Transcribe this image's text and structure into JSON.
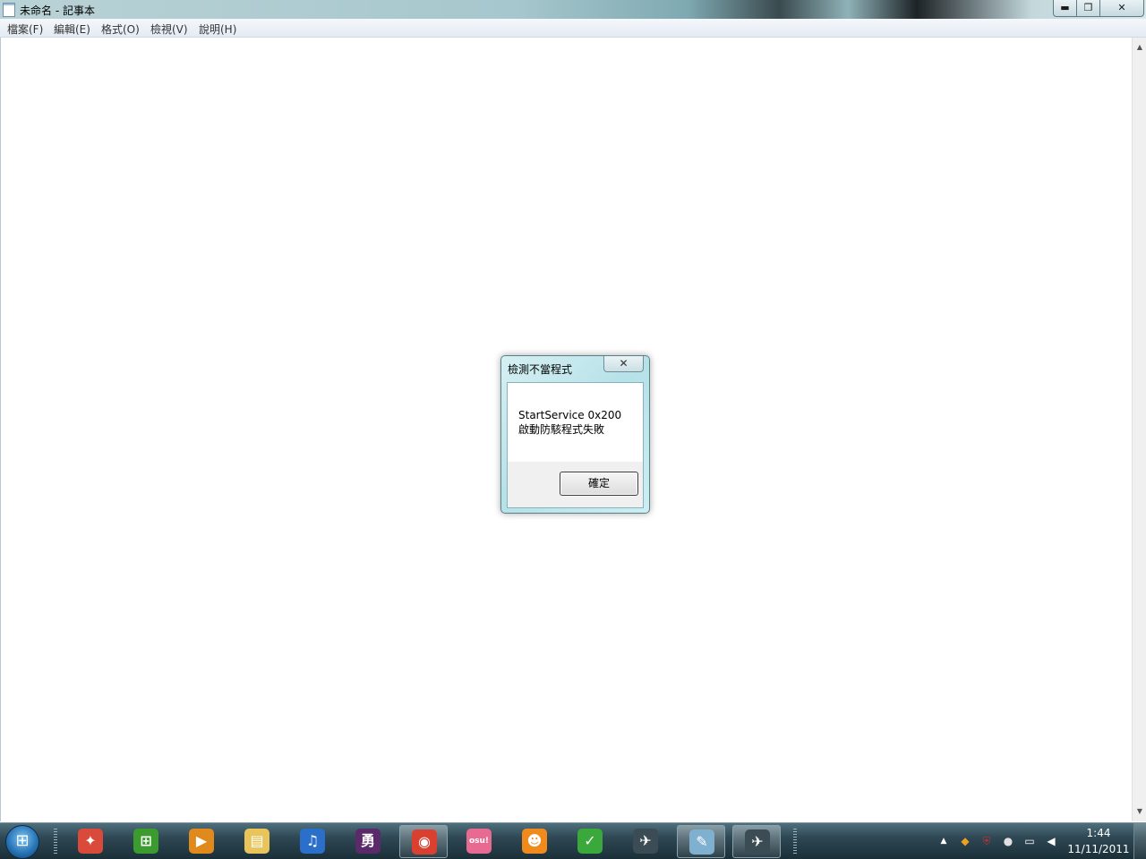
{
  "window": {
    "title": "未命名 - 記事本",
    "minimize_glyph": "▬",
    "maximize_glyph": "❐",
    "close_glyph": "✕"
  },
  "menu": [
    {
      "label": "檔案(F)"
    },
    {
      "label": "編輯(E)"
    },
    {
      "label": "格式(O)"
    },
    {
      "label": "檢視(V)"
    },
    {
      "label": "說明(H)"
    }
  ],
  "editor": {
    "content": ""
  },
  "dialog": {
    "title": "檢測不當程式",
    "close_glyph": "✕",
    "message_lines": [
      "StartService 0x200",
      "啟動防駭程式失敗"
    ],
    "ok_label": "確定"
  },
  "taskbar": {
    "start_icon": "windows-logo-icon",
    "apps": [
      {
        "name": "colorful-app-icon",
        "glyph": "✦",
        "color": "#d94a3a",
        "active": false
      },
      {
        "name": "windows-media-center-icon",
        "glyph": "⊞",
        "color": "#3b9b2f",
        "active": false
      },
      {
        "name": "media-player-icon",
        "glyph": "▶",
        "color": "#e08a1e",
        "active": false
      },
      {
        "name": "file-explorer-icon",
        "glyph": "▤",
        "color": "#e8c45a",
        "active": false
      },
      {
        "name": "itunes-icon",
        "glyph": "♫",
        "color": "#2a6fc9",
        "active": false
      },
      {
        "name": "game-yong-icon",
        "glyph": "勇",
        "color": "#5a2a6a",
        "active": false
      },
      {
        "name": "chrome-icon",
        "glyph": "◉",
        "color": "#d9402f",
        "active": true
      },
      {
        "name": "osu-icon",
        "glyph": "osu!",
        "color": "#e86a92",
        "active": false
      },
      {
        "name": "pps-icon",
        "glyph": "☻",
        "color": "#f08a1c",
        "active": false
      },
      {
        "name": "green-check-app-icon",
        "glyph": "✓",
        "color": "#3aa83a",
        "active": false
      },
      {
        "name": "counter-strike-icon",
        "glyph": "✈",
        "color": "#3c4c55",
        "active": false
      },
      {
        "name": "notepad-icon",
        "glyph": "✎",
        "color": "#7fb0cf",
        "active": true
      },
      {
        "name": "counter-strike-icon-2",
        "glyph": "✈",
        "color": "#3c4c55",
        "active": true
      }
    ],
    "tray": {
      "show_hidden_glyph": "▲",
      "icons": [
        {
          "name": "orange-diamond-icon",
          "glyph": "◆",
          "color": "#f0a020"
        },
        {
          "name": "shield-icon",
          "glyph": "⛨",
          "color": "#c03030"
        },
        {
          "name": "qq-icon",
          "glyph": "●",
          "color": "#e0e0e0"
        },
        {
          "name": "network-icon",
          "glyph": "▭",
          "color": "#ffffff"
        },
        {
          "name": "volume-icon",
          "glyph": "◀",
          "color": "#ffffff"
        }
      ],
      "time": "1:44",
      "date": "11/11/2011"
    }
  }
}
